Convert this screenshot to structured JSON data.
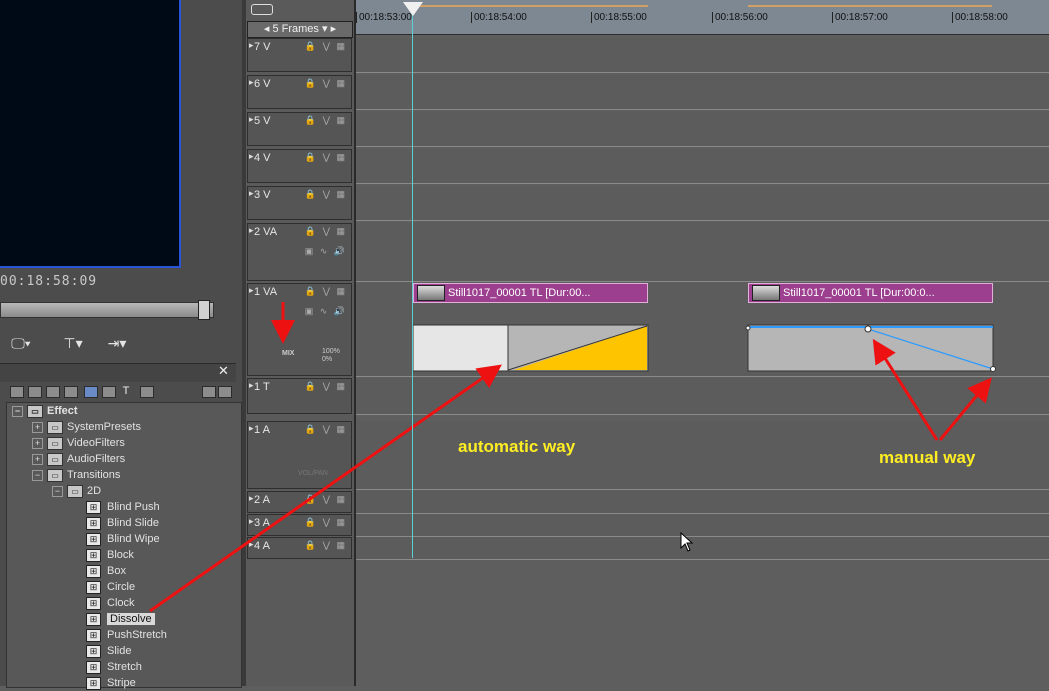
{
  "preview": {
    "timecode": "00:18:58:09"
  },
  "effect_panel": {
    "root_label": "Effect",
    "folders": [
      "SystemPresets",
      "VideoFilters",
      "AudioFilters",
      "Transitions"
    ],
    "subfolder": "2D",
    "items": [
      "Blind Push",
      "Blind Slide",
      "Blind Wipe",
      "Block",
      "Box",
      "Circle",
      "Clock",
      "Dissolve",
      "PushStretch",
      "Slide",
      "Stretch",
      "Stripe"
    ],
    "selected_item": "Dissolve"
  },
  "timeline": {
    "frames_selector": "5 Frames",
    "ruler_ticks": [
      "00:18:53:00",
      "00:18:54:00",
      "00:18:55:00",
      "00:18:56:00",
      "00:18:57:00",
      "00:18:58:00"
    ],
    "tracks": [
      {
        "name": "7 V"
      },
      {
        "name": "6 V"
      },
      {
        "name": "5 V"
      },
      {
        "name": "4 V"
      },
      {
        "name": "3 V"
      },
      {
        "name": "2 VA"
      },
      {
        "name": "1 VA"
      },
      {
        "name": "1 T"
      },
      {
        "name": "1 A"
      },
      {
        "name": "2 A"
      },
      {
        "name": "3 A"
      },
      {
        "name": "4 A"
      }
    ],
    "mix_label": "MIX",
    "mix_levels": "100%\n0%",
    "vol_label": "VOL/PAN",
    "clip_left": "Still1017_00001  TL [Dur:00...",
    "clip_right": "Still1017_00001  TL [Dur:00:0..."
  },
  "annotations": {
    "automatic": "automatic way",
    "manual": "manual way"
  },
  "colors": {
    "clip": "#9c3f8e",
    "transition_fill": "#ffc400",
    "arrow": "#ee1111",
    "annotation_text": "#ffee22",
    "playhead": "#5ccfd0"
  }
}
